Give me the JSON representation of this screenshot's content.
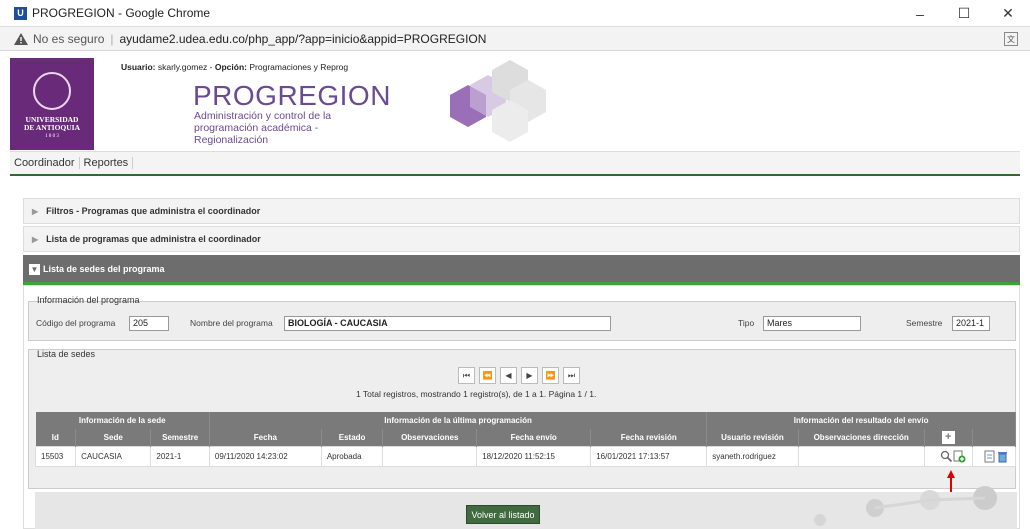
{
  "window": {
    "app_icon_letter": "U",
    "title": "PROGREGION - Google Chrome",
    "minimize": "–",
    "maximize": "☐",
    "close": "✕"
  },
  "address": {
    "not_secure": "No es seguro",
    "separator": "|",
    "url": "ayudame2.udea.edu.co/php_app/?app=inicio&appid=PROGREGION"
  },
  "header": {
    "user_label": "Usuario:",
    "user_value": "skarly.gomez",
    "option_label": "Opción:",
    "option_value": "Programaciones y Reprog",
    "app_name": "PROGREGION",
    "app_desc": "Administración y control de la programación académica - Regionalización",
    "logo_text_1": "UNIVERSIDAD",
    "logo_text_2": "DE ANTIOQUIA",
    "logo_year": "1 8 0 3"
  },
  "menu": [
    "Coordinador",
    "Reportes"
  ],
  "panels": {
    "filtros": "Filtros - Programas que administra el coordinador",
    "lista_programas": "Lista de programas que administra el coordinador",
    "lista_sedes": "Lista de sedes del programa"
  },
  "programa": {
    "legend": "Información del programa",
    "codigo_label": "Código del programa",
    "codigo_value": "205",
    "nombre_label": "Nombre del programa",
    "nombre_value": "BIOLOGÍA - CAUCASIA",
    "tipo_label": "Tipo",
    "tipo_value": "Mares",
    "semestre_label": "Semestre",
    "semestre_value": "2021-1"
  },
  "sedes": {
    "legend": "Lista de sedes",
    "pager_buttons": [
      "⏮",
      "⏪",
      "◀",
      "▶",
      "⏩",
      "⏭"
    ],
    "pager_info": "1 Total registros, mostrando 1 registro(s), de 1 a 1. Página 1 / 1.",
    "group_headers": [
      "Información de la sede",
      "Información de la última programación",
      "Información del resultado del envío"
    ],
    "columns": [
      "Id",
      "Sede",
      "Semestre",
      "Fecha",
      "Estado",
      "Observaciones",
      "Fecha envío",
      "Fecha revisión",
      "Usuario revisión",
      "Observaciones dirección"
    ],
    "add_icon": "add-icon",
    "rows": [
      {
        "id": "15503",
        "sede": "CAUCASIA",
        "semestre": "2021-1",
        "fecha": "09/11/2020 14:23:02",
        "estado": "Aprobada",
        "observaciones": "",
        "fecha_envio": "18/12/2020 11:52:15",
        "fecha_revision": "16/01/2021 17:13:57",
        "usuario_revision": "syaneth.rodriguez",
        "obs_direccion": ""
      }
    ]
  },
  "footer": {
    "volver": "Volver al listado"
  },
  "colors": {
    "brand_purple": "#6a4a93",
    "menu_green": "#2e6b2e",
    "panel_gray": "#6d6d6d",
    "annotation_red": "#e00000"
  }
}
